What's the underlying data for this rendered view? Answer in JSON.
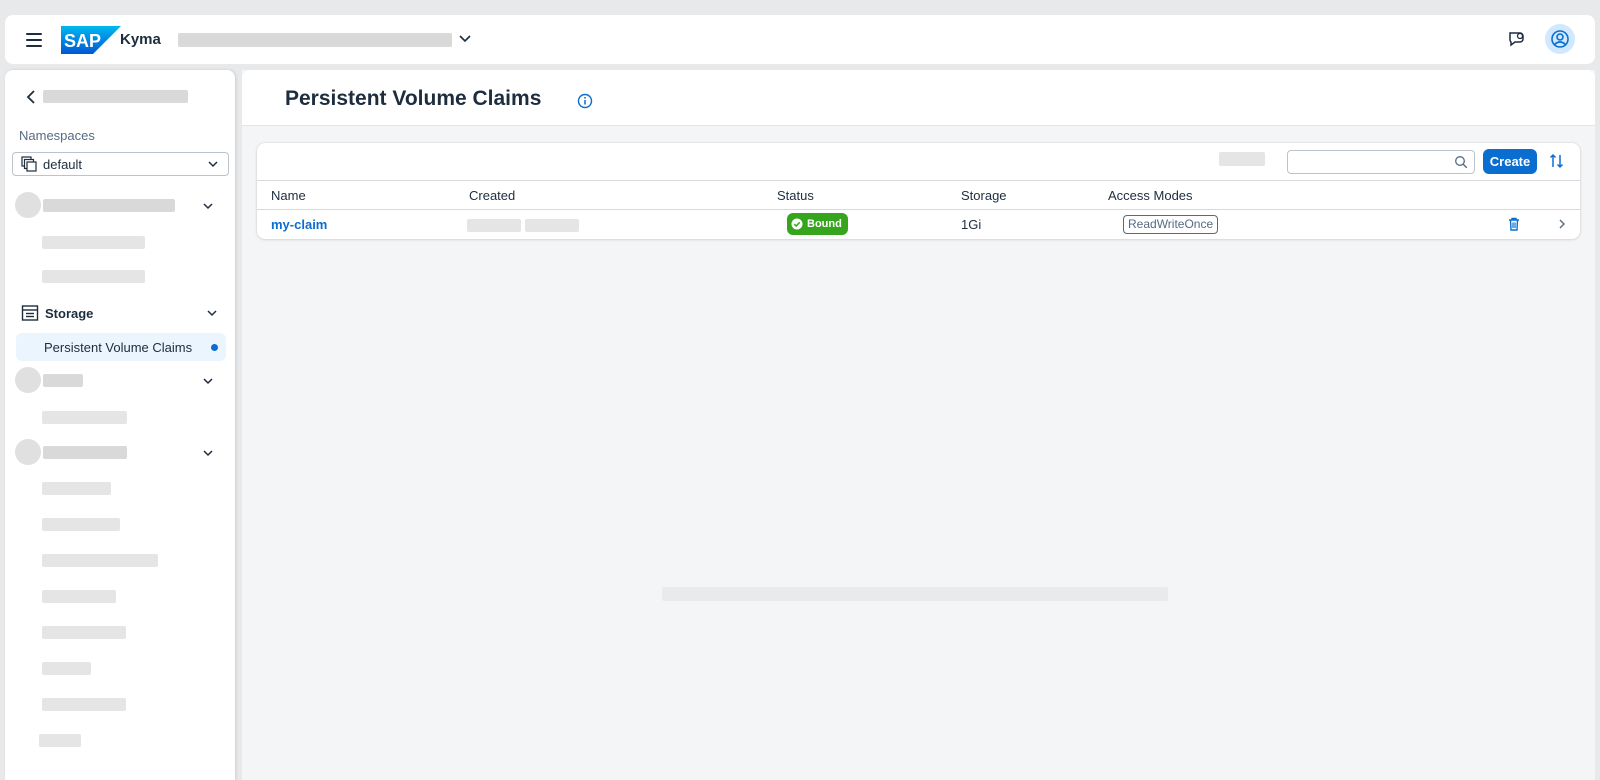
{
  "shell": {
    "brand_logo": "SAP",
    "product_name": "Kyma",
    "icons": {
      "menu": "hamburger-icon",
      "cluster_switch": "chevron-down-icon",
      "feedback": "feedback-icon",
      "user": "user-avatar-icon"
    }
  },
  "sidebar": {
    "namespaces_label": "Namespaces",
    "namespace_value": "default",
    "storage_group_label": "Storage",
    "active_item_label": "Persistent Volume Claims"
  },
  "page": {
    "title": "Persistent Volume Claims"
  },
  "toolbar": {
    "search_value": "",
    "create_label": "Create"
  },
  "table": {
    "columns": [
      "Name",
      "Created",
      "Status",
      "Storage",
      "Access Modes"
    ],
    "rows": [
      {
        "name": "my-claim",
        "status": "Bound",
        "storage": "1Gi",
        "access_modes": "ReadWriteOnce"
      }
    ]
  },
  "colors": {
    "accent": "#0a6ed1",
    "status_positive": "#36a41d",
    "brand_blue": "#0070f2"
  }
}
